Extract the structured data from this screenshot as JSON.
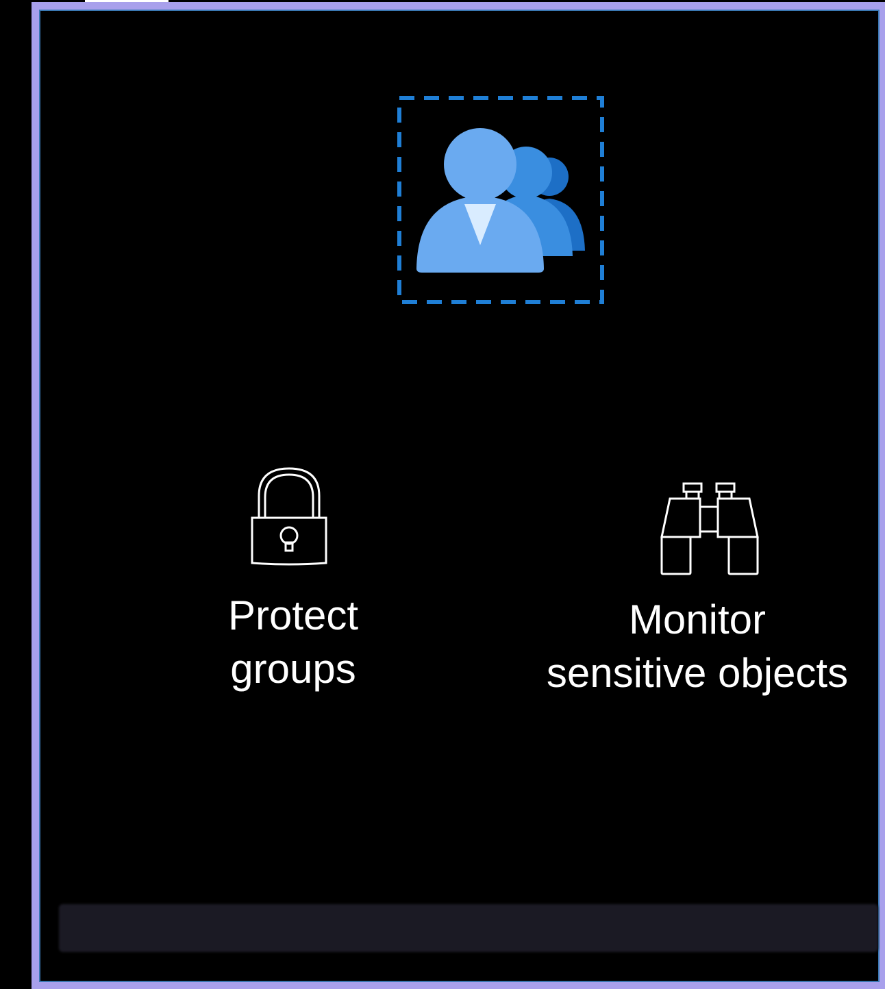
{
  "diagram": {
    "top_icon": "user-group-icon",
    "items": [
      {
        "icon": "padlock-icon",
        "label_lines": [
          "Protect",
          "groups"
        ]
      },
      {
        "icon": "binoculars-icon",
        "label_lines": [
          "Monitor",
          "sensitive objects"
        ]
      }
    ]
  },
  "colors": {
    "background": "#000000",
    "frame": "#a8a0ec",
    "panel_border": "#3a78b2",
    "selection_dash": "#1f7fd6",
    "user_primary": "#6aaaf0",
    "user_secondary": "#3a8ee0",
    "user_tertiary": "#1d6fc6",
    "text": "#ffffff",
    "bottom_bar": "#1b1a24"
  }
}
